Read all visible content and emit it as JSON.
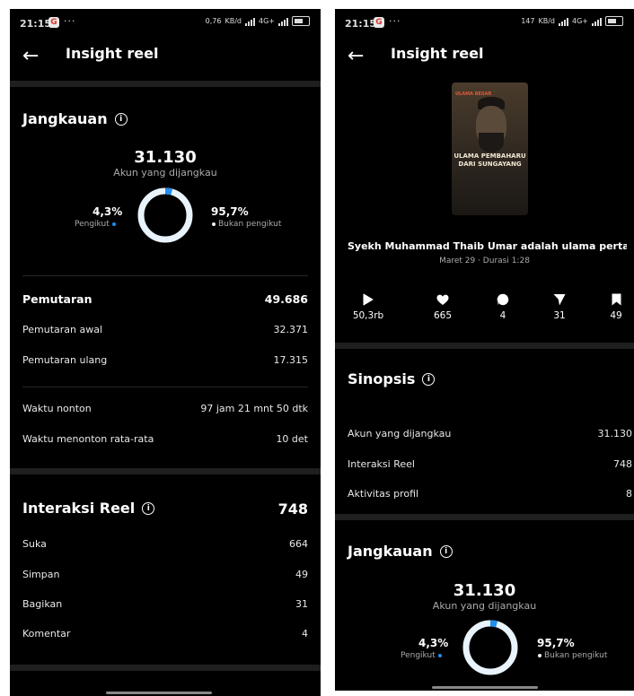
{
  "status_bar": {
    "time": "21:15",
    "dots": "···",
    "left_speed": "0,76",
    "right_speed": "147",
    "speed_unit": "KB/d",
    "network": "4G+"
  },
  "left": {
    "header": {
      "title": "Insight reel"
    },
    "reach": {
      "title": "Jangkauan",
      "total": "31.130",
      "total_label": "Akun yang dijangkau",
      "followers_pct": "4,3%",
      "followers_label": "Pengikut",
      "followers_fraction": 0.043,
      "nonfollowers_pct": "95,7%",
      "nonfollowers_label": "Bukan pengikut"
    },
    "plays": [
      {
        "label": "Pemutaran",
        "value": "49.686"
      },
      {
        "label": "Pemutaran awal",
        "value": "32.371"
      },
      {
        "label": "Pemutaran ulang",
        "value": "17.315"
      }
    ],
    "watch": [
      {
        "label": "Waktu nonton",
        "value": "97 jam 21 mnt 50 dtk"
      },
      {
        "label": "Waktu menonton rata-rata",
        "value": "10 det"
      }
    ],
    "interactions": {
      "title": "Interaksi Reel",
      "total": "748",
      "items": [
        {
          "label": "Suka",
          "value": "664"
        },
        {
          "label": "Simpan",
          "value": "49"
        },
        {
          "label": "Bagikan",
          "value": "31"
        },
        {
          "label": "Komentar",
          "value": "4"
        }
      ]
    }
  },
  "right": {
    "header": {
      "title": "Insight reel"
    },
    "thumbnail": {
      "top_text": "ULAMA BESAR",
      "title_line1": "ULAMA PEMBAHARU",
      "title_line2": "DARI SUNGAYANG"
    },
    "reel": {
      "title": "Syekh Muhammad Thaib Umar adalah ulama pertama y...",
      "date": "Maret 29 · Durasi 1:28"
    },
    "stats": [
      {
        "icon": "play-icon",
        "value": "50,3rb"
      },
      {
        "icon": "heart-icon",
        "value": "665"
      },
      {
        "icon": "comment-icon",
        "value": "4"
      },
      {
        "icon": "share-icon",
        "value": "31"
      },
      {
        "icon": "bookmark-icon",
        "value": "49"
      }
    ],
    "synopsis": {
      "title": "Sinopsis",
      "items": [
        {
          "label": "Akun yang dijangkau",
          "value": "31.130"
        },
        {
          "label": "Interaksi Reel",
          "value": "748"
        },
        {
          "label": "Aktivitas profil",
          "value": "8"
        }
      ]
    },
    "reach": {
      "title": "Jangkauan",
      "total": "31.130",
      "total_label": "Akun yang dijangkau",
      "followers_pct": "4,3%",
      "followers_label": "Pengikut",
      "nonfollowers_pct": "95,7%",
      "nonfollowers_label": "Bukan pengikut"
    }
  },
  "colors": {
    "background": "#000000",
    "accent": "#1f8ef1",
    "donut_main": "#e9f3fc",
    "divider": "#1f1f1f"
  }
}
